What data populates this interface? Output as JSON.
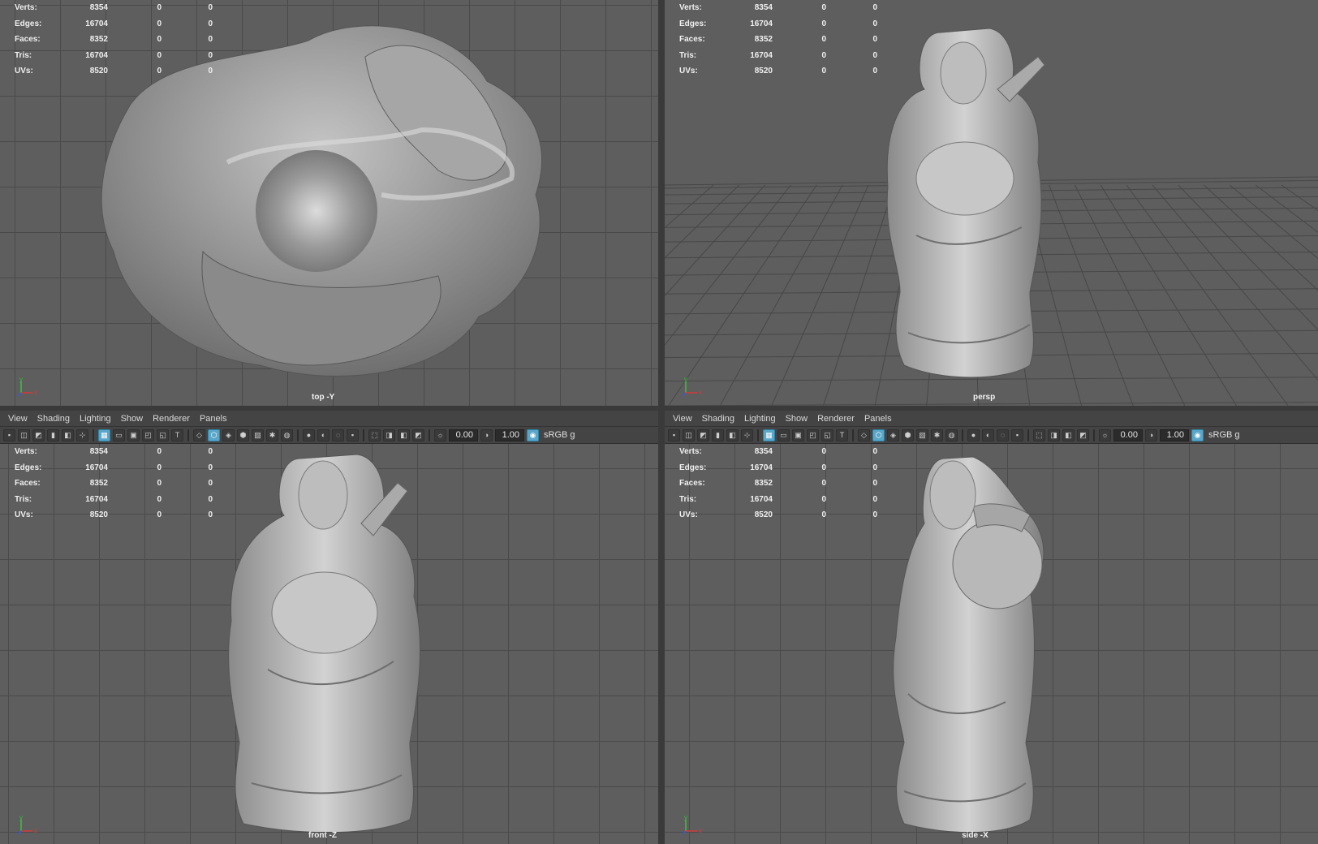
{
  "menus": [
    "View",
    "Shading",
    "Lighting",
    "Show",
    "Renderer",
    "Panels"
  ],
  "toolbar": {
    "field1": "0.00",
    "field2": "1.00",
    "colorspace": "sRGB g"
  },
  "hud_labels": [
    "Verts:",
    "Edges:",
    "Faces:",
    "Tris:",
    "UVs:"
  ],
  "hud_values": [
    [
      "8354",
      "0",
      "0"
    ],
    [
      "16704",
      "0",
      "0"
    ],
    [
      "8352",
      "0",
      "0"
    ],
    [
      "16704",
      "0",
      "0"
    ],
    [
      "8520",
      "0",
      "0"
    ]
  ],
  "viewports": {
    "top": {
      "camera": "top -Y"
    },
    "persp": {
      "camera": "persp"
    },
    "front": {
      "camera": "front -Z"
    },
    "side": {
      "camera": "side -X"
    }
  },
  "axis_letters": {
    "x": "x",
    "y": "y",
    "z": "z"
  },
  "colors": {
    "axis_x": "#d23a3a",
    "axis_y": "#3ac23a",
    "axis_z": "#3a5ad2",
    "active_button": "#5aa6c8"
  },
  "icons": [
    "camera-icon",
    "camera-attr-icon",
    "bookmark-icon",
    "image-plane-icon",
    "grid-icon",
    "film-gate-icon",
    "resolution-gate-icon",
    "safe-action-icon",
    "wireframe-icon",
    "smooth-shade-icon",
    "textured-icon",
    "lights-icon",
    "shadows-icon",
    "isolate-select-icon",
    "xray-icon",
    "exposure-icon",
    "gamma-icon",
    "color-management-icon"
  ]
}
